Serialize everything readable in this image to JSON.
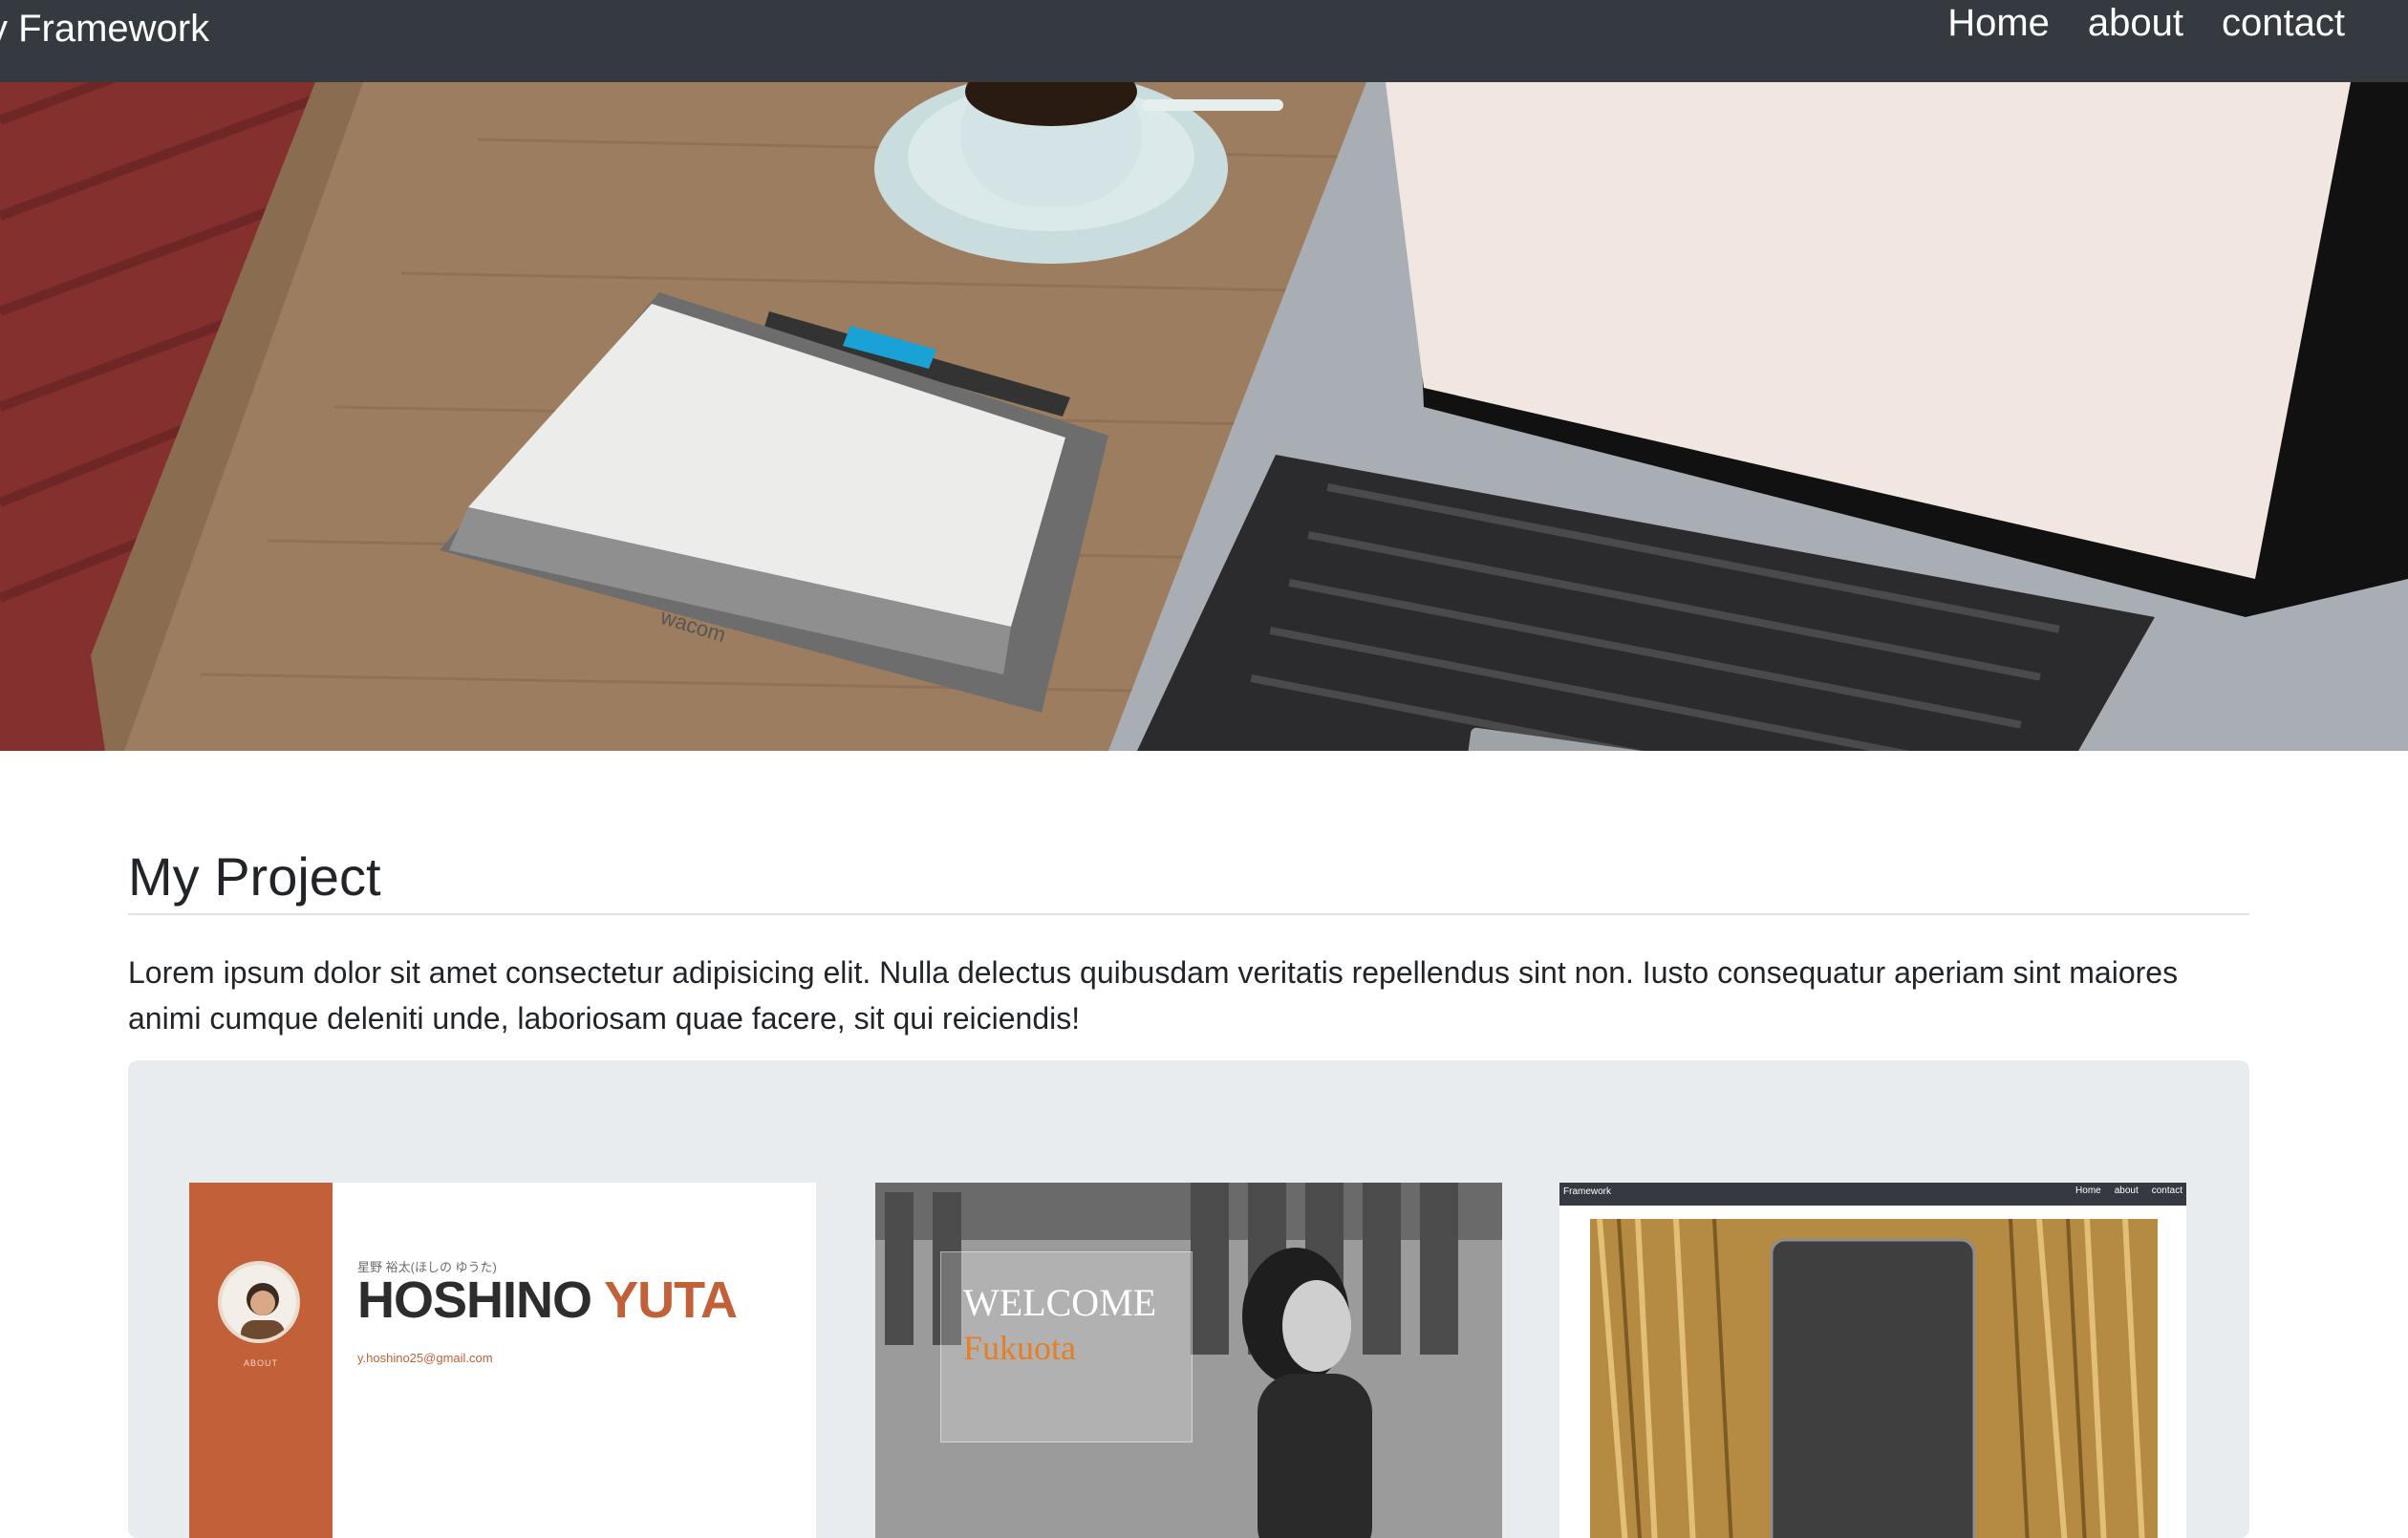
{
  "navbar": {
    "brand": "y Framework",
    "links": [
      "Home",
      "about",
      "contact"
    ]
  },
  "hero": {
    "image": "desk with laptop, coffee cup and pen tablet"
  },
  "project": {
    "title": "My Project",
    "description": "Lorem ipsum dolor sit amet consectetur adipisicing elit. Nulla delectus quibusdam veritatis repellendus sint non. Iusto consequatur aperiam sint maiores animi cumque deleniti unde, laboriosam quae facere, sit qui reiciendis!"
  },
  "cards": [
    {
      "kana": "星野 裕太(ほしの ゆうた)",
      "name_first": "HOSHINO",
      "name_last": "YUTA",
      "email": "y.hoshino25@gmail.com",
      "side_label": "ABOUT"
    },
    {
      "welcome": "WELCOME",
      "subtitle": "Fukuota"
    },
    {
      "brand": "Framework",
      "links": [
        "Home",
        "about",
        "contact"
      ]
    }
  ],
  "colors": {
    "navbar_bg": "#343a40",
    "accent_orange": "#c2603a",
    "gallery_bg": "#e9ecef"
  }
}
